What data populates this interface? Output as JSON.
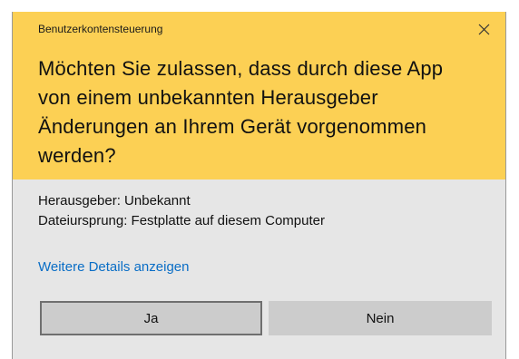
{
  "dialog": {
    "window_title": "Benutzerkontensteuerung",
    "close_glyph": "close-icon",
    "question": "Möchten Sie zulassen, dass durch diese App\nvon einem unbekannten Herausgeber\nÄnderungen an Ihrem Gerät vorgenommen\nwerden?",
    "publisher": "Herausgeber: Unbekannt",
    "file_origin": "Dateiursprung: Festplatte auf diesem Computer",
    "details_link": "Weitere Details anzeigen",
    "buttons": {
      "yes": "Ja",
      "no": "Nein"
    }
  },
  "colors": {
    "header_background": "#fcd054",
    "body_background": "#e6e6e6",
    "link": "#0a6ec6",
    "button_background": "#cccccc",
    "button_focus_border": "#6f6f6f"
  }
}
